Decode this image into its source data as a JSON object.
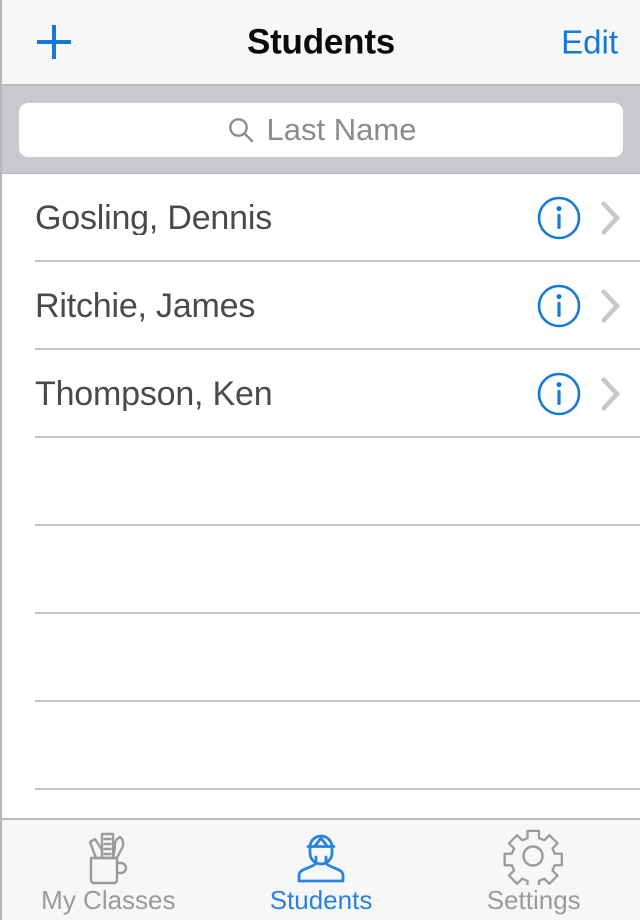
{
  "colors": {
    "accent_blue": "#1679d6",
    "tab_active_blue": "#2a82e0",
    "inactive_gray": "#9a9a9f",
    "nav_background": "#f7f7f7",
    "searchbar_background": "#c9c8ce",
    "separator": "#c5c5c7",
    "row_text": "#4a4a4a",
    "placeholder_gray": "#8b8b90"
  },
  "navbar": {
    "title": "Students",
    "add_label": "+",
    "add_icon": "plus-icon",
    "edit_label": "Edit"
  },
  "search": {
    "placeholder": "Last Name",
    "value": "",
    "icon": "search-icon"
  },
  "list": {
    "rows": [
      {
        "name": "Gosling, Dennis",
        "info_icon": "info-circle-icon",
        "disclosure_icon": "chevron-right-icon"
      },
      {
        "name": "Ritchie, James",
        "info_icon": "info-circle-icon",
        "disclosure_icon": "chevron-right-icon"
      },
      {
        "name": "Thompson, Ken",
        "info_icon": "info-circle-icon",
        "disclosure_icon": "chevron-right-icon"
      }
    ],
    "empty_row_count": 5
  },
  "tabbar": {
    "items": [
      {
        "label": "My Classes",
        "icon": "pencil-cup-icon",
        "active": false
      },
      {
        "label": "Students",
        "icon": "graduate-person-icon",
        "active": true
      },
      {
        "label": "Settings",
        "icon": "gear-icon",
        "active": false
      }
    ]
  }
}
